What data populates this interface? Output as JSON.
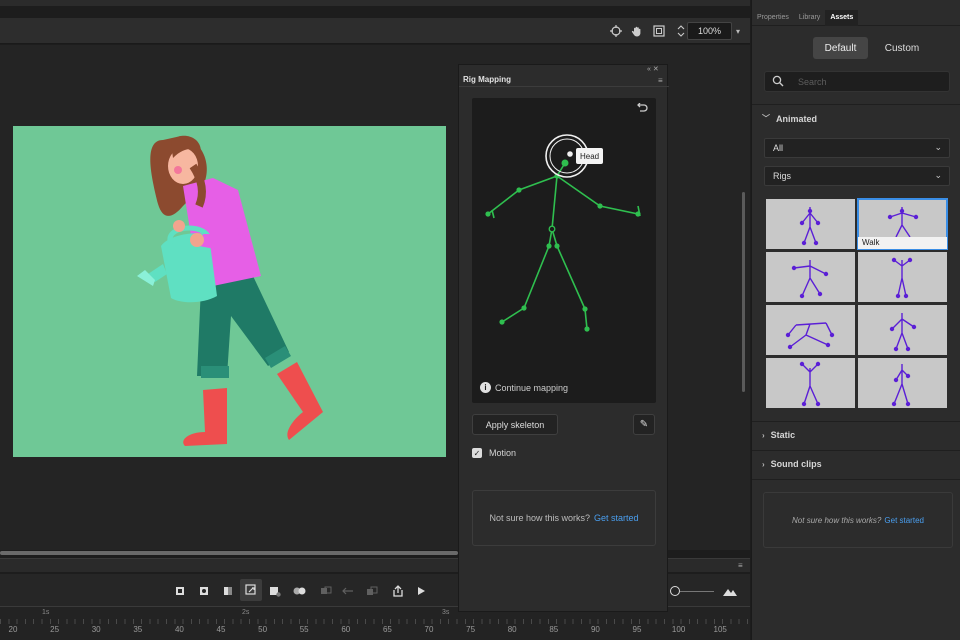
{
  "toolbar": {
    "zoom": "100%",
    "icons": [
      "target-icon",
      "hand-icon",
      "frame-icon",
      "stepper-icon"
    ]
  },
  "rig_panel": {
    "title": "Rig Mapping",
    "head_label": "Head",
    "continue_mapping": "Continue mapping",
    "apply_skeleton": "Apply skeleton",
    "motion_label": "Motion",
    "help_text": "Not sure how this works?",
    "help_link": "Get started"
  },
  "right_panel": {
    "tabs": [
      "Properties",
      "Library",
      "Assets"
    ],
    "active_tab": "Assets",
    "segments": {
      "default": "Default",
      "custom": "Custom"
    },
    "search": {
      "placeholder": "Search",
      "value": ""
    },
    "sections": {
      "animated": "Animated",
      "static": "Static",
      "sound_clips": "Sound clips"
    },
    "filter_type": "All",
    "filter_category": "Rigs",
    "selected_item": "Walk",
    "help_text": "Not sure how this works?",
    "help_link": "Get started"
  },
  "timeline": {
    "seconds": [
      "1s",
      "2s",
      "3s"
    ],
    "frames": [
      "20",
      "25",
      "30",
      "35",
      "40",
      "45",
      "50",
      "55",
      "60",
      "65",
      "70",
      "75",
      "80",
      "85",
      "90",
      "95",
      "100",
      "105"
    ]
  },
  "colors": {
    "stage": "#6fc896",
    "accent": "#3a8ee6",
    "rig": "#2fbf4f",
    "thumb_rig": "#5b1fd6"
  }
}
